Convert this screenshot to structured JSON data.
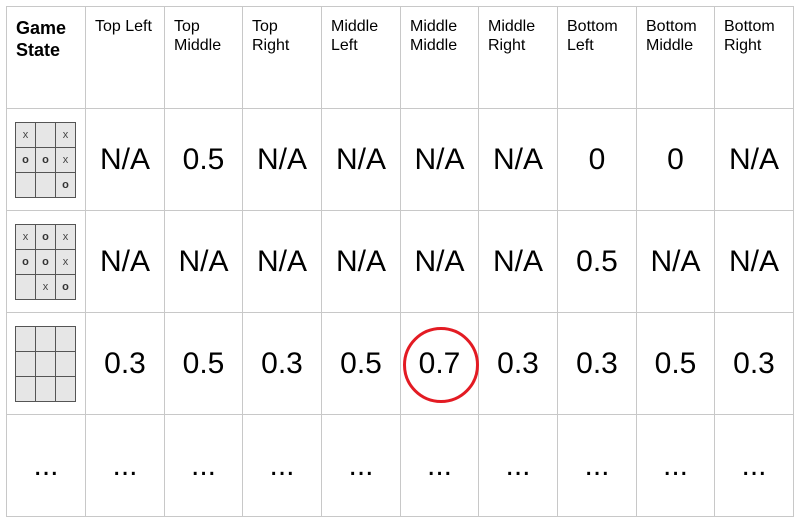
{
  "headers": [
    "Game\nState",
    "Top Left",
    "Top\nMiddle",
    "Top\nRight",
    "Middle\nLeft",
    "Middle\nMiddle",
    "Middle\nRight",
    "Bottom\nLeft",
    "Bottom\nMiddle",
    "Bottom\nRight"
  ],
  "rows": [
    {
      "board": [
        "x",
        "",
        "x",
        "o",
        "o",
        "x",
        "",
        "",
        "o"
      ],
      "values": [
        "N/A",
        "0.5",
        "N/A",
        "N/A",
        "N/A",
        "N/A",
        "0",
        "0",
        "N/A"
      ]
    },
    {
      "board": [
        "x",
        "o",
        "x",
        "o",
        "o",
        "x",
        "",
        "x",
        "o"
      ],
      "values": [
        "N/A",
        "N/A",
        "N/A",
        "N/A",
        "N/A",
        "N/A",
        "0.5",
        "N/A",
        "N/A"
      ]
    },
    {
      "board": [
        "",
        "",
        "",
        "",
        "",
        "",
        "",
        "",
        ""
      ],
      "values": [
        "0.3",
        "0.5",
        "0.3",
        "0.5",
        "0.7",
        "0.3",
        "0.3",
        "0.5",
        "0.3"
      ],
      "highlighted_index": 4,
      "highlight_color": "#e31b23"
    },
    {
      "state": "...",
      "values": [
        "...",
        "...",
        "...",
        "...",
        "...",
        "...",
        "...",
        "...",
        "..."
      ]
    }
  ]
}
